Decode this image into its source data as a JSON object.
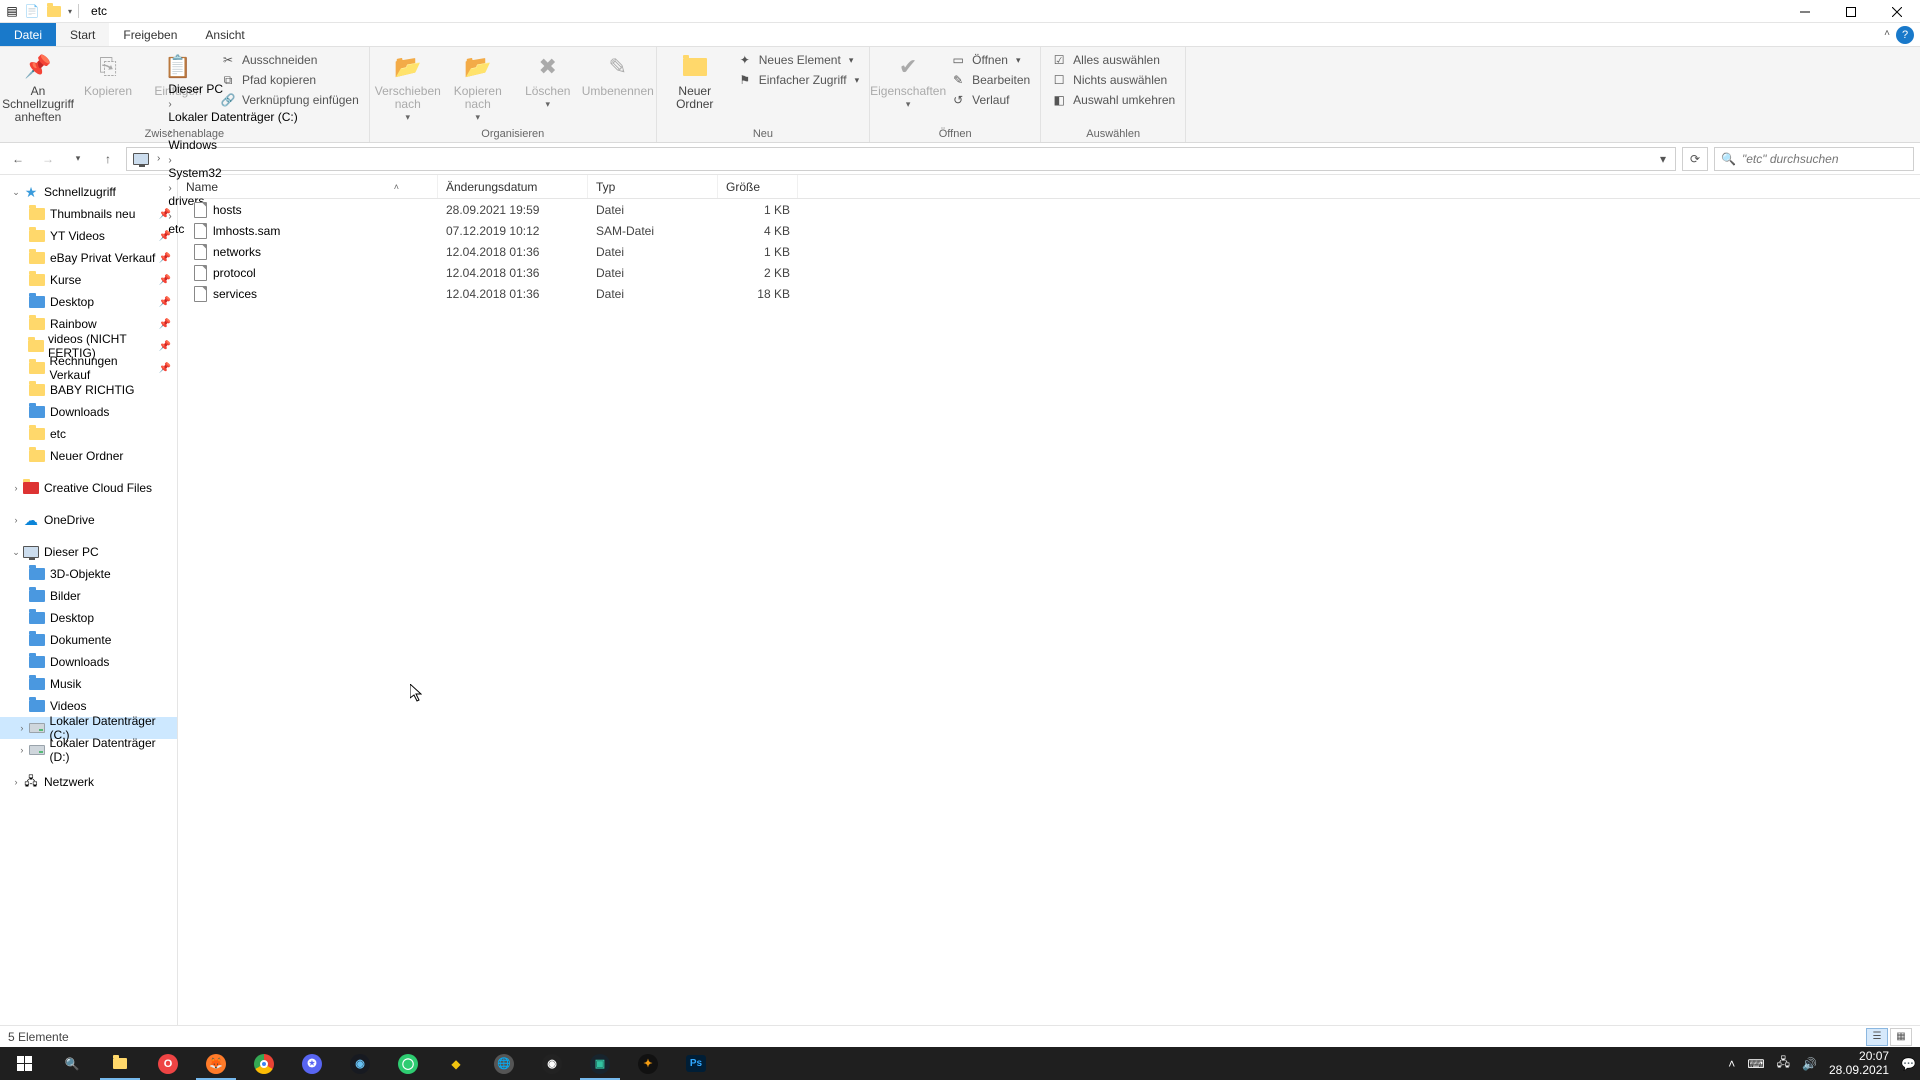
{
  "window": {
    "title": "etc"
  },
  "tabs": {
    "file": "Datei",
    "start": "Start",
    "share": "Freigeben",
    "view": "Ansicht"
  },
  "ribbon": {
    "clipboard": {
      "label": "Zwischenablage",
      "pin": "An Schnellzugriff anheften",
      "copy": "Kopieren",
      "paste": "Einfügen",
      "cut": "Ausschneiden",
      "copy_path": "Pfad kopieren",
      "paste_shortcut": "Verknüpfung einfügen"
    },
    "organize": {
      "label": "Organisieren",
      "move_to": "Verschieben nach",
      "copy_to": "Kopieren nach",
      "delete": "Löschen",
      "rename": "Umbenennen"
    },
    "new": {
      "label": "Neu",
      "new_folder": "Neuer Ordner",
      "new_item": "Neues Element",
      "easy_access": "Einfacher Zugriff"
    },
    "open": {
      "label": "Öffnen",
      "properties": "Eigenschaften",
      "open": "Öffnen",
      "edit": "Bearbeiten",
      "history": "Verlauf"
    },
    "select": {
      "label": "Auswählen",
      "select_all": "Alles auswählen",
      "select_none": "Nichts auswählen",
      "invert": "Auswahl umkehren"
    }
  },
  "breadcrumb": [
    "Dieser PC",
    "Lokaler Datenträger (C:)",
    "Windows",
    "System32",
    "drivers",
    "etc"
  ],
  "search": {
    "placeholder": "\"etc\" durchsuchen"
  },
  "columns": {
    "name": "Name",
    "date": "Änderungsdatum",
    "type": "Typ",
    "size": "Größe"
  },
  "files": [
    {
      "name": "hosts",
      "date": "28.09.2021 19:59",
      "type": "Datei",
      "size": "1 KB"
    },
    {
      "name": "lmhosts.sam",
      "date": "07.12.2019 10:12",
      "type": "SAM-Datei",
      "size": "4 KB"
    },
    {
      "name": "networks",
      "date": "12.04.2018 01:36",
      "type": "Datei",
      "size": "1 KB"
    },
    {
      "name": "protocol",
      "date": "12.04.2018 01:36",
      "type": "Datei",
      "size": "2 KB"
    },
    {
      "name": "services",
      "date": "12.04.2018 01:36",
      "type": "Datei",
      "size": "18 KB"
    }
  ],
  "sidebar": {
    "quick_access": "Schnellzugriff",
    "qa_items": [
      {
        "label": "Thumbnails neu",
        "pinned": true
      },
      {
        "label": "YT Videos",
        "pinned": true
      },
      {
        "label": "eBay Privat Verkauf",
        "pinned": true
      },
      {
        "label": "Kurse",
        "pinned": true
      },
      {
        "label": "Desktop",
        "pinned": true,
        "blue": true
      },
      {
        "label": "Rainbow",
        "pinned": true
      },
      {
        "label": "videos (NICHT FERTIG)",
        "pinned": true
      },
      {
        "label": "Rechnungen Verkauf",
        "pinned": true
      },
      {
        "label": "BABY RICHTIG",
        "pinned": false
      },
      {
        "label": "Downloads",
        "pinned": false,
        "blue": true
      },
      {
        "label": "etc",
        "pinned": false
      },
      {
        "label": "Neuer Ordner",
        "pinned": false
      }
    ],
    "creative_cloud": "Creative Cloud Files",
    "onedrive": "OneDrive",
    "this_pc": "Dieser PC",
    "pc_items": [
      {
        "label": "3D-Objekte",
        "blue": true
      },
      {
        "label": "Bilder",
        "blue": true
      },
      {
        "label": "Desktop",
        "blue": true
      },
      {
        "label": "Dokumente",
        "blue": true
      },
      {
        "label": "Downloads",
        "blue": true
      },
      {
        "label": "Musik",
        "blue": true
      },
      {
        "label": "Videos",
        "blue": true
      },
      {
        "label": "Lokaler Datenträger (C:)",
        "disk": true,
        "selected": true
      },
      {
        "label": "Lokaler Datenträger (D:)",
        "disk": true
      }
    ],
    "network": "Netzwerk"
  },
  "status": {
    "text": "5 Elemente"
  },
  "tray": {
    "time": "20:07",
    "date": "28.09.2021"
  }
}
